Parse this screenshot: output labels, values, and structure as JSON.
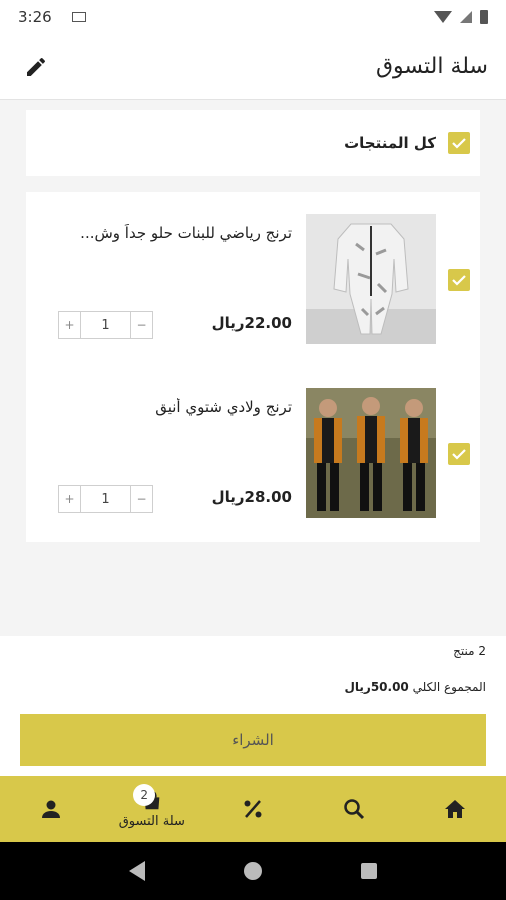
{
  "status_bar": {
    "time": "3:26"
  },
  "header": {
    "title": "سلة التسوق"
  },
  "select_all": {
    "label": "كل المنتجات"
  },
  "items": [
    {
      "name": "ترنج رياضي للبنات حلو جداً وش...",
      "price": "22.00ريال",
      "quantity": "1",
      "plus": "+",
      "minus": "−"
    },
    {
      "name": "ترنج ولادي شتوي أنيق",
      "price": "28.00ريال",
      "quantity": "1",
      "plus": "+",
      "minus": "−"
    }
  ],
  "summary": {
    "count": "2 منتج",
    "total_label": "المجموع الكلي ",
    "total_value": "50.00ريال",
    "buy_label": "الشراء"
  },
  "bottom_nav": {
    "cart_label": "سلة التسوق",
    "cart_badge": "2"
  },
  "colors": {
    "accent": "#d8c84a"
  }
}
